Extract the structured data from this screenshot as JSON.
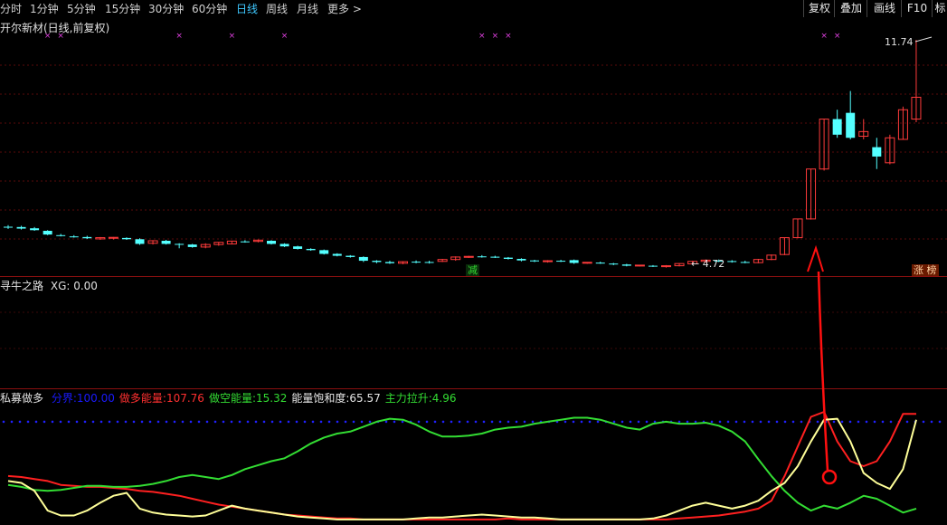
{
  "toolbar": {
    "periods": [
      {
        "label": "分时",
        "active": false
      },
      {
        "label": "1分钟",
        "active": false
      },
      {
        "label": "5分钟",
        "active": false
      },
      {
        "label": "15分钟",
        "active": false
      },
      {
        "label": "30分钟",
        "active": false
      },
      {
        "label": "60分钟",
        "active": false
      },
      {
        "label": "日线",
        "active": true
      },
      {
        "label": "周线",
        "active": false
      },
      {
        "label": "月线",
        "active": false
      },
      {
        "label": "更多 >",
        "active": false
      }
    ],
    "buttons": [
      "复权",
      "叠加",
      "画线",
      "F10",
      "标"
    ]
  },
  "main_panel": {
    "title": "开尔新材(日线,前复权)",
    "high_label": "11.74",
    "low_label": "4.72",
    "badge_reduce": "减",
    "badge_limit_up": "涨 榜"
  },
  "indicator1": {
    "name": "寻牛之路",
    "value_text": "XG: 0.00"
  },
  "indicator2": {
    "name": "私募做多",
    "items": [
      {
        "label": "分界:",
        "value": "100.00",
        "color": "#1a1aff"
      },
      {
        "label": "做多能量:",
        "value": "107.76",
        "color": "#ff3030"
      },
      {
        "label": "做空能量:",
        "value": "15.32",
        "color": "#33dd33"
      },
      {
        "label": "能量饱和度:",
        "value": "65.57",
        "color": "#e6e6e6"
      },
      {
        "label": "主力拉升:",
        "value": "4.96",
        "color": "#33dd33"
      }
    ]
  },
  "colors": {
    "up": "#ff3b3b",
    "down": "#54ffff",
    "green": "#33dd33",
    "yellow": "#ffff99",
    "red": "#ff2020",
    "blue": "#2020ff",
    "marker": "#e040e0"
  },
  "chart_data": {
    "type": "candlestick",
    "ohlc": [
      [
        5.75,
        5.8,
        5.68,
        5.72
      ],
      [
        5.74,
        5.78,
        5.66,
        5.69
      ],
      [
        5.7,
        5.74,
        5.62,
        5.64
      ],
      [
        5.62,
        5.64,
        5.48,
        5.5
      ],
      [
        5.48,
        5.52,
        5.44,
        5.47
      ],
      [
        5.44,
        5.48,
        5.4,
        5.43
      ],
      [
        5.42,
        5.46,
        5.36,
        5.38
      ],
      [
        5.36,
        5.42,
        5.33,
        5.4
      ],
      [
        5.38,
        5.42,
        5.34,
        5.41
      ],
      [
        5.39,
        5.41,
        5.33,
        5.35
      ],
      [
        5.35,
        5.38,
        5.17,
        5.2
      ],
      [
        5.22,
        5.32,
        5.18,
        5.3
      ],
      [
        5.3,
        5.33,
        5.18,
        5.2
      ],
      [
        5.2,
        5.22,
        5.06,
        5.18
      ],
      [
        5.18,
        5.2,
        5.08,
        5.1
      ],
      [
        5.1,
        5.22,
        5.06,
        5.18
      ],
      [
        5.18,
        5.26,
        5.14,
        5.25
      ],
      [
        5.2,
        5.3,
        5.18,
        5.29
      ],
      [
        5.28,
        5.32,
        5.24,
        5.27
      ],
      [
        5.28,
        5.34,
        5.25,
        5.32
      ],
      [
        5.3,
        5.32,
        5.18,
        5.2
      ],
      [
        5.2,
        5.22,
        5.1,
        5.12
      ],
      [
        5.12,
        5.14,
        5.02,
        5.04
      ],
      [
        5.04,
        5.06,
        4.98,
        5.0
      ],
      [
        5.0,
        5.02,
        4.86,
        4.88
      ],
      [
        4.88,
        4.9,
        4.8,
        4.82
      ],
      [
        4.82,
        4.84,
        4.76,
        4.78
      ],
      [
        4.78,
        4.8,
        4.62,
        4.66
      ],
      [
        4.66,
        4.68,
        4.58,
        4.62
      ],
      [
        4.62,
        4.66,
        4.56,
        4.58
      ],
      [
        4.58,
        4.64,
        4.55,
        4.63
      ],
      [
        4.63,
        4.67,
        4.58,
        4.62
      ],
      [
        4.62,
        4.66,
        4.57,
        4.61
      ],
      [
        4.64,
        4.72,
        4.62,
        4.7
      ],
      [
        4.7,
        4.8,
        4.66,
        4.78
      ],
      [
        4.77,
        4.82,
        4.75,
        4.8
      ],
      [
        4.8,
        4.84,
        4.76,
        4.79
      ],
      [
        4.79,
        4.82,
        4.75,
        4.76
      ],
      [
        4.76,
        4.78,
        4.7,
        4.72
      ],
      [
        4.72,
        4.74,
        4.64,
        4.67
      ],
      [
        4.67,
        4.69,
        4.62,
        4.64
      ],
      [
        4.64,
        4.68,
        4.6,
        4.66
      ],
      [
        4.66,
        4.69,
        4.62,
        4.65
      ],
      [
        4.68,
        4.7,
        4.56,
        4.59
      ],
      [
        4.59,
        4.62,
        4.56,
        4.61
      ],
      [
        4.6,
        4.63,
        4.56,
        4.57
      ],
      [
        4.57,
        4.59,
        4.52,
        4.54
      ],
      [
        4.54,
        4.56,
        4.48,
        4.5
      ],
      [
        4.5,
        4.53,
        4.48,
        4.52
      ],
      [
        4.5,
        4.52,
        4.46,
        4.48
      ],
      [
        4.47,
        4.52,
        4.44,
        4.5
      ],
      [
        4.5,
        4.58,
        4.48,
        4.57
      ],
      [
        4.56,
        4.66,
        4.54,
        4.64
      ],
      [
        4.64,
        4.7,
        4.6,
        4.68
      ],
      [
        4.66,
        4.7,
        4.62,
        4.65
      ],
      [
        4.65,
        4.68,
        4.6,
        4.62
      ],
      [
        4.62,
        4.66,
        4.58,
        4.6
      ],
      [
        4.6,
        4.72,
        4.58,
        4.7
      ],
      [
        4.7,
        4.86,
        4.68,
        4.84
      ],
      [
        4.86,
        5.4,
        4.84,
        5.4
      ],
      [
        5.4,
        6.0,
        5.38,
        6.0
      ],
      [
        6.0,
        7.6,
        5.98,
        7.6
      ],
      [
        7.6,
        9.2,
        7.55,
        9.2
      ],
      [
        9.2,
        9.5,
        8.6,
        8.7
      ],
      [
        9.4,
        10.1,
        8.55,
        8.6
      ],
      [
        8.65,
        9.2,
        8.55,
        8.8
      ],
      [
        8.3,
        8.6,
        7.6,
        8.0
      ],
      [
        7.8,
        8.7,
        7.75,
        8.6
      ],
      [
        8.55,
        9.6,
        8.55,
        9.5
      ],
      [
        9.2,
        11.74,
        9.1,
        9.9
      ]
    ],
    "high_marker": 11.74,
    "low_marker": 4.72,
    "marker_indices": [
      3,
      4,
      13,
      17,
      21,
      36,
      37,
      38,
      62,
      63
    ],
    "indicator2": {
      "reference_line": 100,
      "series": [
        {
          "name": "做多能量",
          "color": "red",
          "values": [
            45,
            44,
            42,
            40,
            36,
            35,
            34,
            34,
            33,
            32,
            30,
            29,
            27,
            25,
            22,
            19,
            16,
            14,
            12,
            10,
            8,
            6,
            5,
            4,
            3,
            2,
            2,
            1,
            1,
            1,
            1,
            1,
            1,
            1,
            1,
            1,
            1,
            1,
            2,
            1,
            1,
            1,
            1,
            1,
            1,
            1,
            1,
            1,
            1,
            1,
            1,
            2,
            3,
            4,
            5,
            7,
            9,
            12,
            20,
            45,
            75,
            105,
            110,
            80,
            60,
            55,
            60,
            80,
            108,
            108
          ]
        },
        {
          "name": "做空能量",
          "color": "green",
          "values": [
            36,
            34,
            31,
            30,
            31,
            33,
            35,
            35,
            34,
            34,
            35,
            37,
            40,
            44,
            46,
            44,
            42,
            46,
            52,
            56,
            60,
            63,
            70,
            78,
            84,
            88,
            90,
            95,
            100,
            103,
            102,
            97,
            90,
            85,
            85,
            86,
            88,
            92,
            94,
            95,
            98,
            100,
            102,
            104,
            104,
            102,
            98,
            94,
            92,
            98,
            100,
            98,
            98,
            99,
            96,
            90,
            80,
            62,
            45,
            30,
            18,
            10,
            15,
            12,
            18,
            25,
            22,
            15,
            8,
            12
          ]
        },
        {
          "name": "能量饱和度",
          "color": "yellow",
          "values": [
            40,
            38,
            30,
            10,
            5,
            5,
            10,
            18,
            25,
            28,
            12,
            8,
            6,
            5,
            4,
            5,
            10,
            15,
            12,
            10,
            8,
            6,
            4,
            3,
            2,
            1,
            1,
            1,
            1,
            1,
            1,
            2,
            3,
            3,
            4,
            5,
            6,
            5,
            4,
            3,
            3,
            2,
            1,
            1,
            1,
            1,
            1,
            1,
            1,
            2,
            5,
            10,
            15,
            18,
            15,
            12,
            15,
            20,
            30,
            38,
            55,
            80,
            102,
            103,
            80,
            48,
            38,
            32,
            52,
            102
          ]
        }
      ]
    }
  }
}
